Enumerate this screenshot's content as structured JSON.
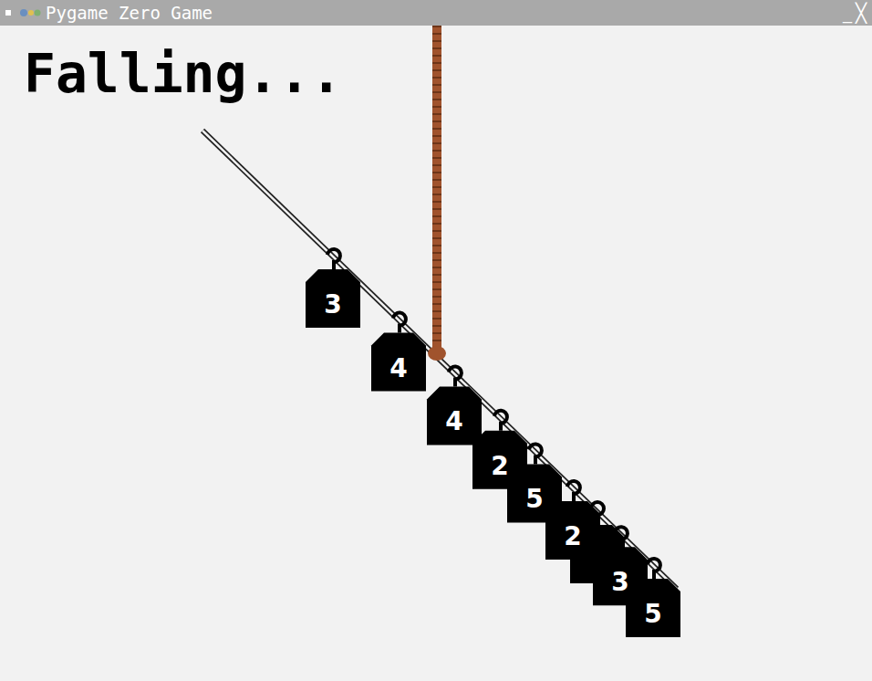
{
  "window": {
    "title": "Pygame Zero Game",
    "controls": [
      "_",
      "╳"
    ]
  },
  "status": "Falling...",
  "weights": [
    {
      "label": "3"
    },
    {
      "label": "4"
    },
    {
      "label": "4"
    },
    {
      "label": "2"
    },
    {
      "label": "5"
    },
    {
      "label": "2"
    },
    {
      "label": "3"
    },
    {
      "label": "5"
    }
  ]
}
